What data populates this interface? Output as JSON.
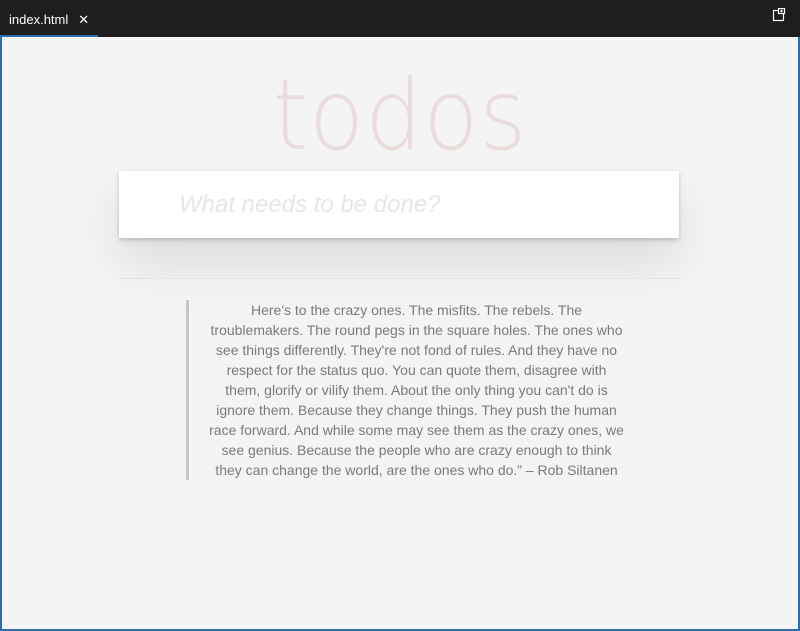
{
  "tab": {
    "title": "index.html",
    "close_symbol": "✕"
  },
  "toolbar": {
    "split_editor_icon": "split-editor-icon"
  },
  "app": {
    "title": "todos",
    "new_todo_placeholder": "What needs to be done?",
    "quote": "Here's to the crazy ones. The misfits. The rebels. The troublemakers. The round pegs in the square holes. The ones who see things differently. They're not fond of rules. And they have no respect for the status quo. You can quote them, disagree with them, glorify or vilify them. About the only thing you can't do is ignore them. Because they change things. They push the human race forward. And while some may see them as the crazy ones, we see genius. Because the people who are crazy enough to think they can change the world, are the ones who do.” – Rob Siltanen"
  },
  "colors": {
    "titlebar": "#1e1e1e",
    "accent": "#2a6fb0",
    "background": "#f4f4f4",
    "title_text": "#efdfdf"
  }
}
